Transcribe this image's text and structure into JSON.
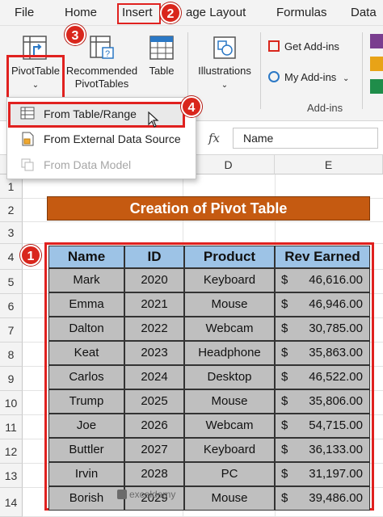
{
  "menu": {
    "tabs": [
      "File",
      "Home",
      "Insert",
      "age Layout",
      "Formulas",
      "Data"
    ]
  },
  "ribbon": {
    "pivottable": "PivotTable",
    "recommended_line1": "Recommended",
    "recommended_line2": "PivotTables",
    "table": "Table",
    "illustrations": "Illustrations",
    "get_addins": "Get Add-ins",
    "my_addins": "My Add-ins",
    "addins_group": "Add-ins"
  },
  "dropdown": {
    "item1": "From Table/Range",
    "item2": "From External Data Source",
    "item3": "From Data Model"
  },
  "formula_bar": {
    "fx": "fx",
    "value": "Name"
  },
  "columns": [
    "D",
    "E"
  ],
  "rows": [
    "1",
    "2",
    "3",
    "4",
    "5",
    "6",
    "7",
    "8",
    "9",
    "10",
    "11",
    "12",
    "13",
    "14"
  ],
  "callouts": [
    "1",
    "2",
    "3",
    "4"
  ],
  "sheet": {
    "title": "Creation of Pivot Table",
    "headers": [
      "Name",
      "ID",
      "Product",
      "Rev Earned"
    ],
    "rows": [
      {
        "name": "Mark",
        "id": "2020",
        "product": "Keyboard",
        "rev": "46,616.00"
      },
      {
        "name": "Emma",
        "id": "2021",
        "product": "Mouse",
        "rev": "46,946.00"
      },
      {
        "name": "Dalton",
        "id": "2022",
        "product": "Webcam",
        "rev": "30,785.00"
      },
      {
        "name": "Keat",
        "id": "2023",
        "product": "Headphone",
        "rev": "35,863.00"
      },
      {
        "name": "Carlos",
        "id": "2024",
        "product": "Desktop",
        "rev": "46,522.00"
      },
      {
        "name": "Trump",
        "id": "2025",
        "product": "Mouse",
        "rev": "35,806.00"
      },
      {
        "name": "Joe",
        "id": "2026",
        "product": "Webcam",
        "rev": "54,715.00"
      },
      {
        "name": "Buttler",
        "id": "2027",
        "product": "Keyboard",
        "rev": "36,133.00"
      },
      {
        "name": "Irvin",
        "id": "2028",
        "product": "PC",
        "rev": "31,197.00"
      },
      {
        "name": "Borish",
        "id": "2029",
        "product": "Mouse",
        "rev": "39,486.00"
      }
    ],
    "currency": "$"
  },
  "watermark": "exceldemy",
  "colors": {
    "accent_red": "#e0211f",
    "title_fill": "#c55a11",
    "header_fill": "#9dc3e6",
    "cell_fill": "#bfbfbf"
  }
}
